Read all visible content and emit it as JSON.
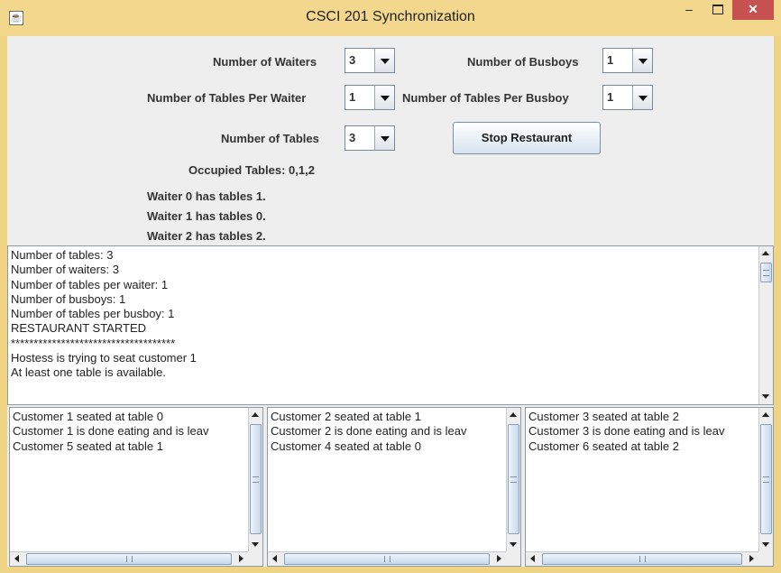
{
  "window": {
    "title": "CSCI 201 Synchronization",
    "minimize": "–",
    "close": "✕"
  },
  "controls": {
    "waiters": {
      "label": "Number of Waiters",
      "value": "3"
    },
    "busboys": {
      "label": "Number of Busboys",
      "value": "1"
    },
    "tables_per_waiter": {
      "label": "Number of Tables Per Waiter",
      "value": "1"
    },
    "tables_per_busboy": {
      "label": "Number of Tables Per Busboy",
      "value": "1"
    },
    "tables": {
      "label": "Number of Tables",
      "value": "3"
    },
    "stop_button": "Stop Restaurant"
  },
  "status": {
    "occupied": "Occupied Tables: 0,1,2",
    "waiters": [
      "Waiter 0 has tables 1.",
      "Waiter 1 has tables 0.",
      "Waiter 2 has tables 2."
    ]
  },
  "log": [
    "Number of tables: 3",
    "Number of waiters: 3",
    "Number of tables per waiter: 1",
    "Number of busboys: 1",
    "Number of tables per busboy: 1",
    "RESTAURANT STARTED",
    "************************************",
    "Hostess is trying to seat customer 1",
    "At least one table is available."
  ],
  "waiter_panels": [
    [
      "Customer 1 seated at table 0",
      "Customer 1 is done eating and is leav",
      "Customer 5 seated at table 1"
    ],
    [
      "Customer 2 seated at table 1",
      "Customer 2 is done eating and is leav",
      "Customer 4 seated at table 0"
    ],
    [
      "Customer 3 seated at table 2",
      "Customer 3 is done eating and is leav",
      "Customer 6 seated at table 2"
    ]
  ],
  "colors": {
    "title_bar": "#f2d78c",
    "close_button": "#c75050",
    "panel_bg": "#eeeeee"
  }
}
